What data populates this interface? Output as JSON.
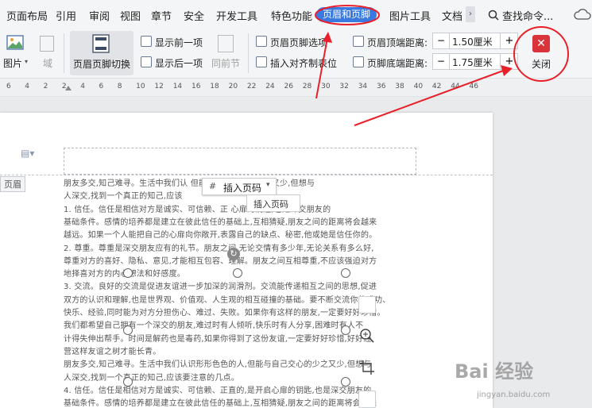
{
  "menu": {
    "items": [
      {
        "label": "页面布局"
      },
      {
        "label": "引用"
      },
      {
        "label": "审阅"
      },
      {
        "label": "视图"
      },
      {
        "label": "章节"
      },
      {
        "label": "安全"
      },
      {
        "label": "开发工具"
      },
      {
        "label": "特色功能"
      },
      {
        "label": "页眉和页脚",
        "active": true
      },
      {
        "label": "图片工具"
      },
      {
        "label": "文档"
      }
    ],
    "search_label": "查找命令..."
  },
  "ribbon": {
    "picture_label": "图片",
    "field_label": "域",
    "switch_label": "页眉页脚切换",
    "show_prev": "显示前一项",
    "show_next": "显示后一项",
    "same_as_prev": "同前节",
    "hf_options": "页眉页脚选项",
    "insert_align_tab": "插入对齐制表位",
    "header_top_label": "页眉顶端距离:",
    "header_top_value": "1.50厘米",
    "footer_bottom_label": "页脚底端距离:",
    "footer_bottom_value": "1.75厘米",
    "minus": "−",
    "plus": "+",
    "close_label": "关闭",
    "close_icon": "✕"
  },
  "ruler": {
    "numbers": [
      "6",
      "4",
      "2",
      "2",
      "4",
      "6",
      "8",
      "10",
      "12",
      "14",
      "16",
      "18",
      "20",
      "22",
      "24",
      "26",
      "28",
      "30",
      "32",
      "34",
      "36",
      "38",
      "40",
      "42",
      "44",
      "46"
    ]
  },
  "document": {
    "header_tag": "页眉",
    "insert_page_num_button": "插入页码",
    "insert_page_num_tooltip": "插入页码",
    "lines": [
      "朋友多交,知己难寻。生活中我们认                    但能与自己交心的少之又少,但想与",
      "人深交,找到一个真正的知己,应该",
      "1. 信任。信任是相信对方是诚实、可信赖、正                    心扉的钥匙,也是深交朋友的",
      "基础条件。感情的培养都是建立在彼此信任的基础上,互相猜疑,朋友之间的距离将会越来",
      "越远。如果一个人能把自己的心扉向你敞开,表露自己的缺点、秘密,他或她是信任你的。",
      "2. 尊重。尊重是深交朋友应有的礼节。朋友之间,无论交情有多少年,无论关系有多么好,",
      "尊重对方的喜好、隐私、意见,才能相互包容、理解。朋友之间互相尊重,不应该强迫对方",
      "地择喜对方的内心想法和好感度。",
      "3. 交流。良好的交流是促进友谊进一步加深的润滑剂。交流能传递相互之间的思想,促进",
      "双方的认识和理解,也是世界观、价值观、人生观的相互碰撞的基础。要不断交流你的成功、",
      "快乐、经验,同时能为对方分担伤心、难过、失败。如果你有这样的朋友,一定要好好珍惜。",
      "    我们都希望自己拥有一个深交的朋友,难过时有人倾听,快乐时有人分享,困难时有人不",
      "计得失伸出帮手。时间是解药也是毒药,如果你得到了这份友谊,一定要好好珍惜,好好经",
      "营这样友谊之树才能长青。",
      "朋友多交,知己难寻。生活中我们认识形形色色的人,但能与自己交心的少之又少,但想与",
      "人深交,找到一个真正的知己,应该要注意的几点。",
      "4. 信任。信任是相信对方是诚实、可信赖、正直的,是开启心扉的钥匙,也是深交朋友的",
      "基础条件。感情的培养都是建立在彼此信任的基础上,互相猜疑,朋友之间的距离将会越来"
    ]
  },
  "watermark": {
    "brand_text": "Bai  经验",
    "url_text": "jingyan.baidu.com"
  }
}
